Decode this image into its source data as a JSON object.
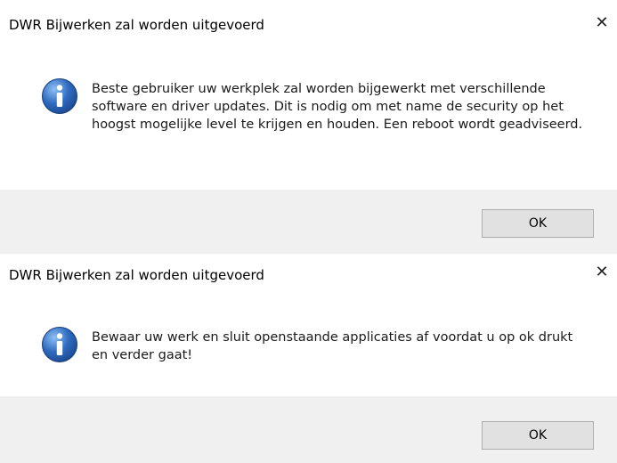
{
  "dialogs": [
    {
      "title": "DWR Bijwerken zal worden uitgevoerd",
      "close_label": "✕",
      "icon": "info-icon",
      "message": "Beste gebruiker uw werkplek zal worden bijgewerkt met verschillende software en driver updates. Dit is nodig om met name de security op het hoogst mogelijke level te krijgen en houden. Een reboot wordt geadviseerd.",
      "ok_label": "OK"
    },
    {
      "title": "DWR Bijwerken zal worden uitgevoerd",
      "close_label": "✕",
      "icon": "info-icon",
      "message": "Bewaar uw werk en sluit openstaande applicaties af voordat u op ok drukt en verder gaat!",
      "ok_label": "OK"
    }
  ],
  "colors": {
    "icon_blue": "#2f6bc0",
    "footer_bg": "#f0f0f0",
    "button_bg": "#e1e1e1",
    "button_border": "#adadad"
  }
}
